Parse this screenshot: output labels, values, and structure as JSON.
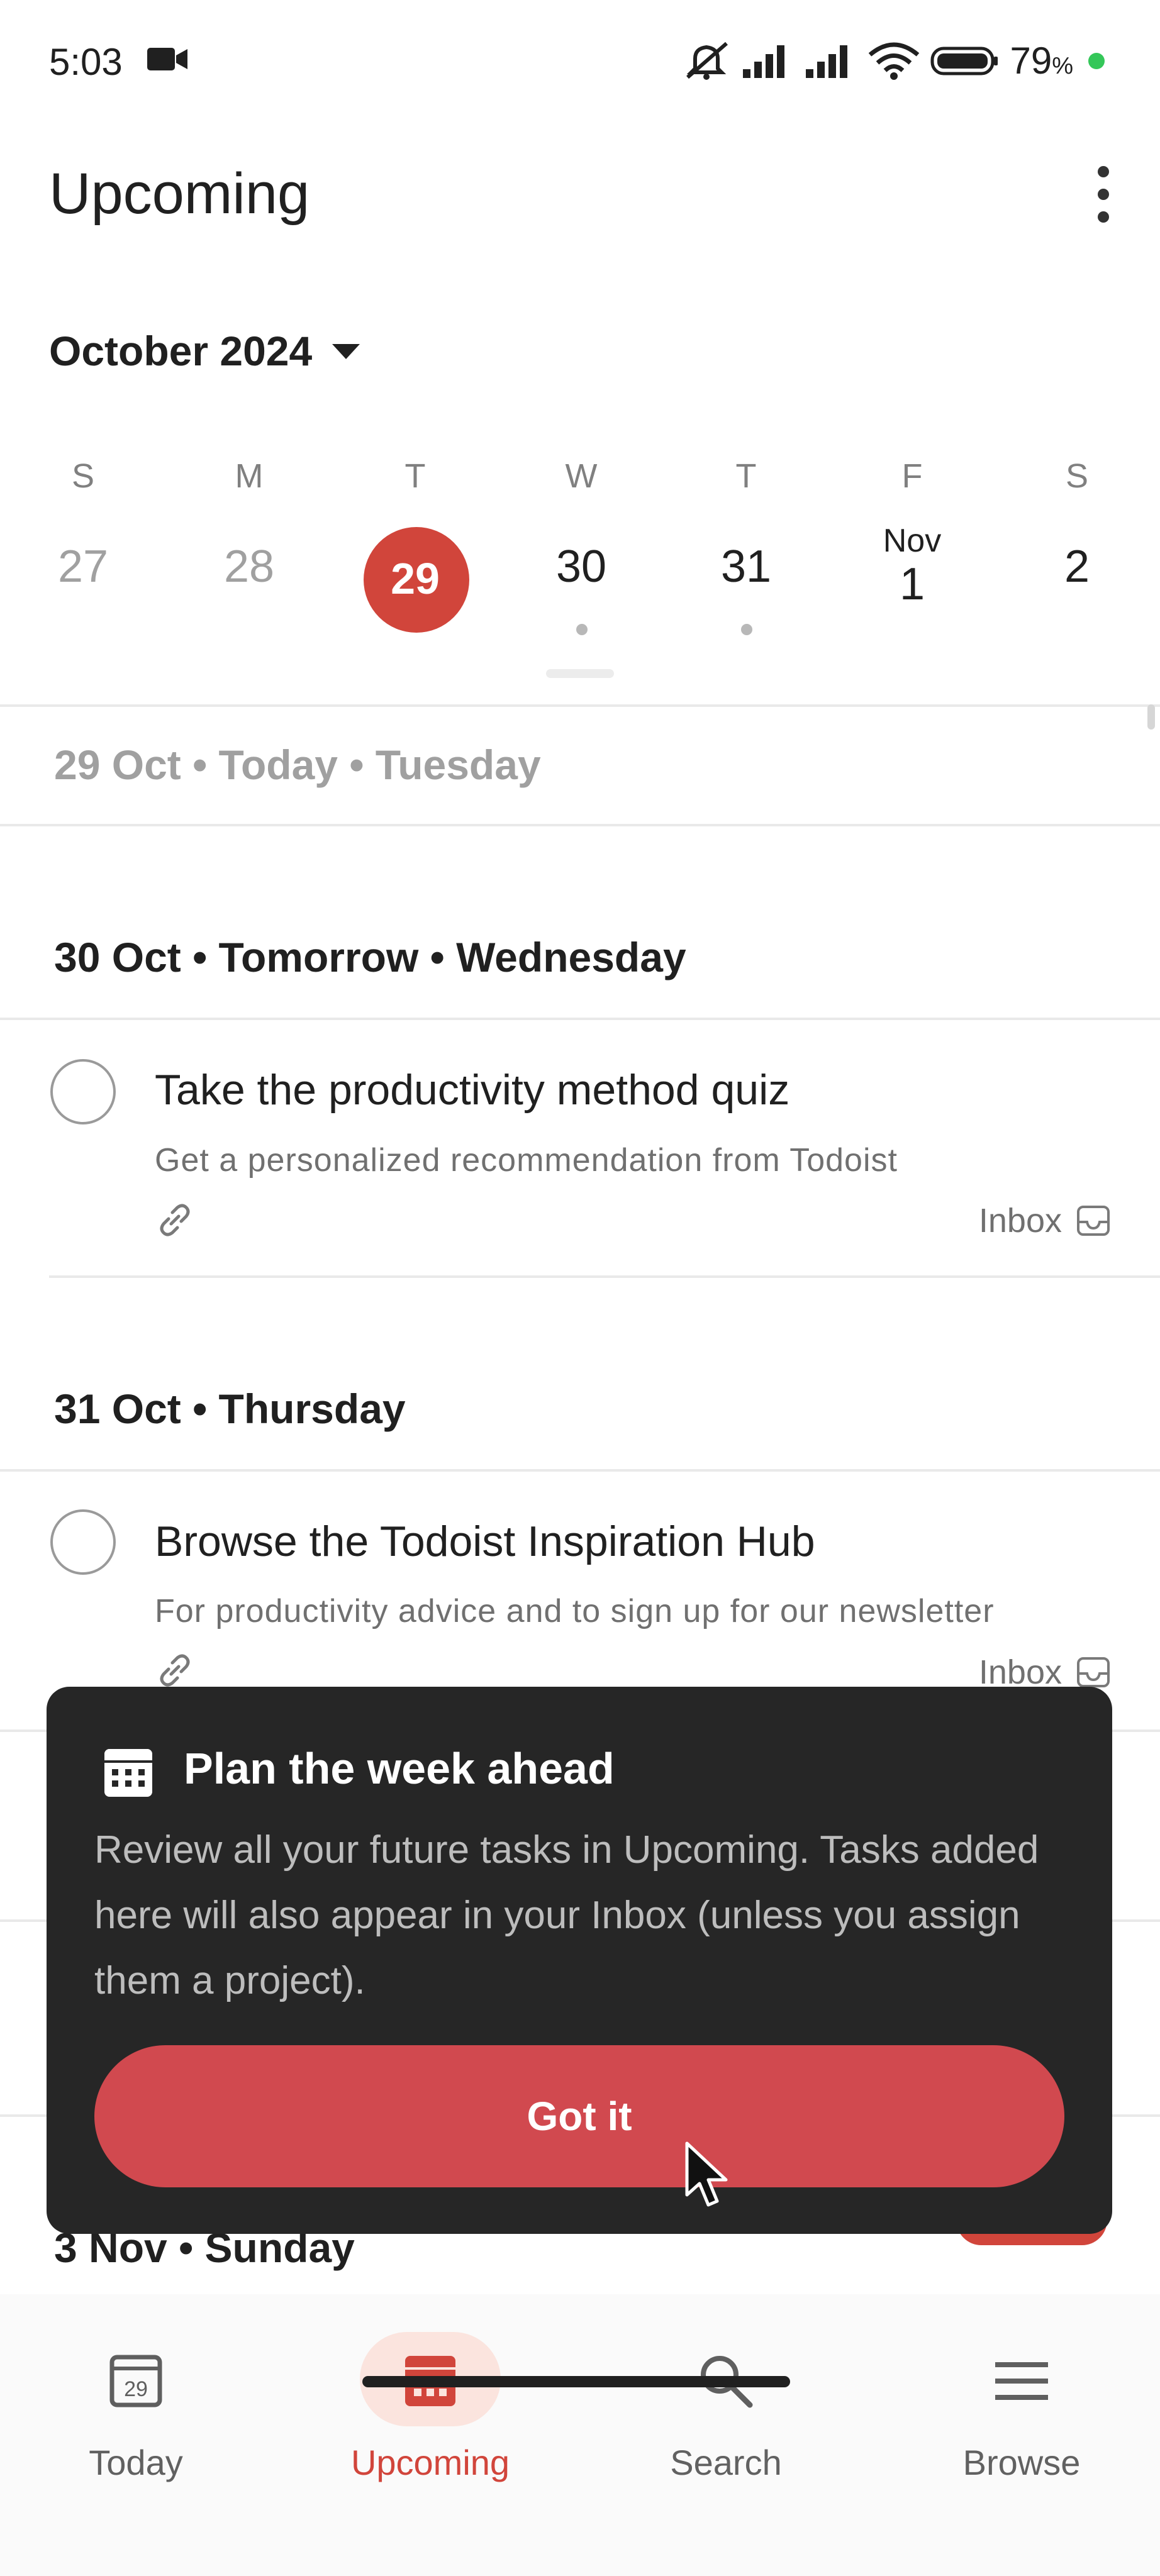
{
  "status_bar": {
    "time": "5:03",
    "battery": "79",
    "battery_unit": "%",
    "battery_dot_color": "#34c759",
    "icons": [
      "video-camera-icon",
      "mute-icon",
      "signal-icon",
      "signal-icon",
      "wifi-icon",
      "battery-icon"
    ]
  },
  "header": {
    "title": "Upcoming"
  },
  "calendar": {
    "month": "October 2024",
    "days": [
      {
        "letter": "S",
        "num": "27",
        "past": true
      },
      {
        "letter": "M",
        "num": "28",
        "past": true
      },
      {
        "letter": "T",
        "num": "29",
        "today": true
      },
      {
        "letter": "W",
        "num": "30",
        "has_tasks": true
      },
      {
        "letter": "T",
        "num": "31",
        "has_tasks": true
      },
      {
        "letter": "F",
        "num": "1",
        "month_label": "Nov"
      },
      {
        "letter": "S",
        "num": "2"
      }
    ],
    "accent_color": "#d1453b"
  },
  "sections": {
    "today": "29 Oct • Today • Tuesday",
    "tomorrow": "30 Oct • Tomorrow • Wednesday",
    "thursday": "31 Oct • Thursday",
    "sunday": "3 Nov • Sunday"
  },
  "tasks": [
    {
      "title": "Take the productivity method quiz",
      "description": "Get a personalized recommendation from Todoist",
      "project": "Inbox"
    },
    {
      "title": "Browse the Todoist Inspiration Hub",
      "description": "For productivity advice and to sign up for our newsletter",
      "project": "Inbox"
    }
  ],
  "dialog": {
    "title": "Plan the week ahead",
    "body": "Review all your future tasks in Upcoming. Tasks added here will also appear in your Inbox (unless you assign them a project).",
    "button": "Got it"
  },
  "bottom_nav": {
    "items": [
      {
        "label": "Today",
        "icon": "calendar-today-icon"
      },
      {
        "label": "Upcoming",
        "icon": "calendar-grid-icon",
        "active": true
      },
      {
        "label": "Search",
        "icon": "search-icon"
      },
      {
        "label": "Browse",
        "icon": "hamburger-icon"
      }
    ],
    "today_icon_number": "29"
  }
}
